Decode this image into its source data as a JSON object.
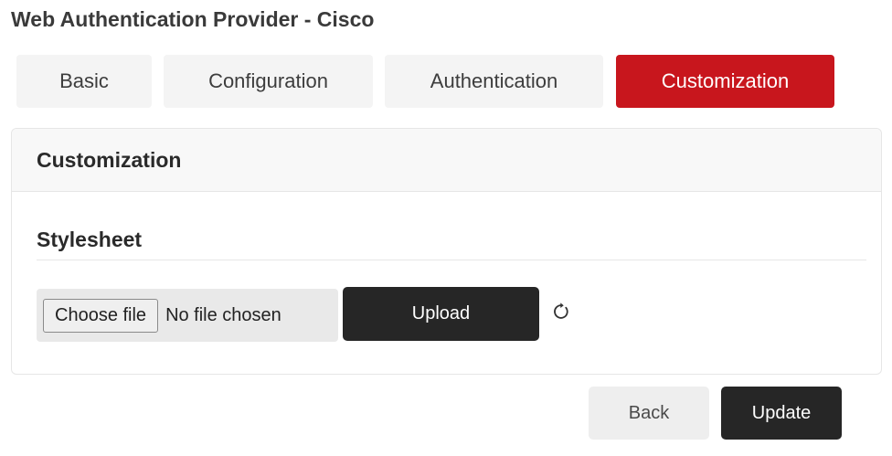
{
  "page": {
    "title": "Web Authentication Provider - Cisco"
  },
  "tabs": [
    {
      "label": "Basic",
      "active": false
    },
    {
      "label": "Configuration",
      "active": false
    },
    {
      "label": "Authentication",
      "active": false
    },
    {
      "label": "Customization",
      "active": true
    }
  ],
  "panel": {
    "title": "Customization",
    "stylesheet": {
      "title": "Stylesheet",
      "choose_file_label": "Choose file",
      "file_status": "No file chosen",
      "upload_label": "Upload",
      "refresh_icon": "refresh-icon"
    }
  },
  "actions": {
    "back_label": "Back",
    "update_label": "Update"
  },
  "colors": {
    "accent": "#c8161d",
    "dark_button": "#262626",
    "light_button": "#eeeeee"
  }
}
